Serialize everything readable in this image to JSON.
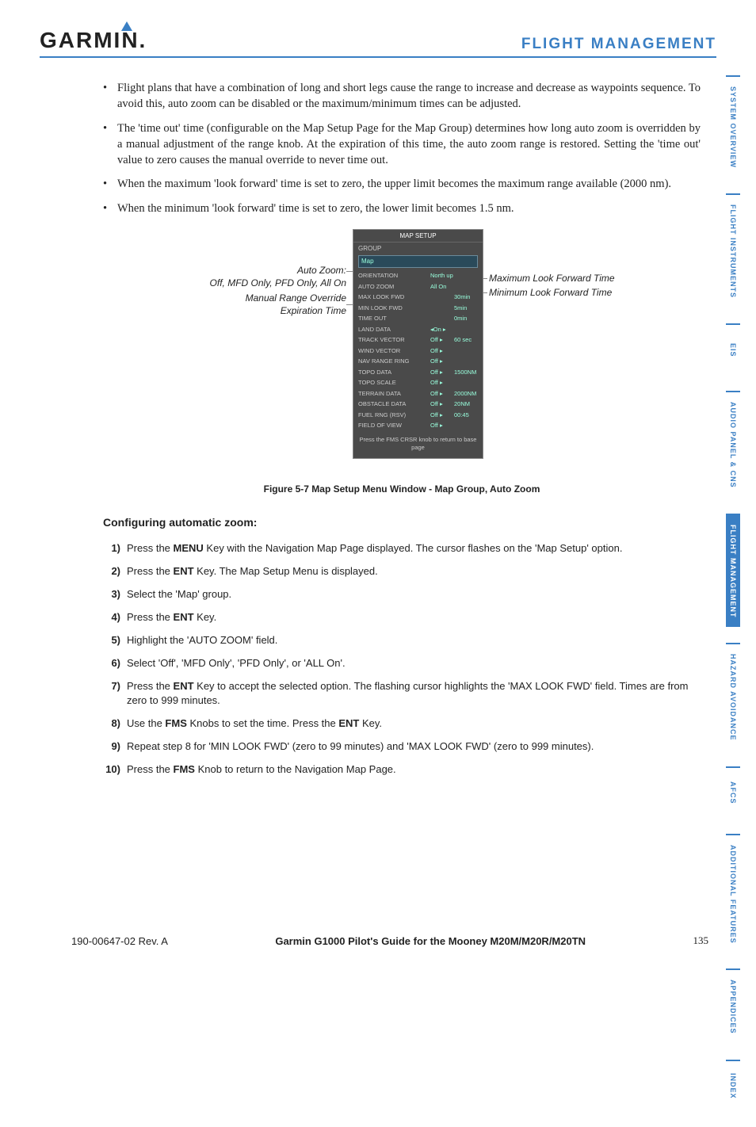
{
  "logo": "GARMIN",
  "section_title": "FLIGHT MANAGEMENT",
  "bullets": [
    "Flight plans that have a combination of long and short legs cause the range to increase and decrease as waypoints sequence.  To avoid this, auto zoom can be disabled or the maximum/minimum times can be adjusted.",
    "The 'time out' time (configurable on the Map Setup Page for the Map Group) determines how long auto zoom is overridden by a manual adjustment of the range knob.  At the expiration of this time, the auto zoom range is restored.  Setting the 'time out' value to zero causes the manual override to never time out.",
    "When the maximum 'look forward' time is set to zero, the upper limit becomes the maximum range available (2000 nm).",
    "When the minimum 'look forward' time is set to zero, the lower limit becomes 1.5 nm."
  ],
  "callouts": {
    "auto_zoom_title": "Auto Zoom:",
    "auto_zoom_sub": "Off, MFD Only, PFD Only, All On",
    "manual_line1": "Manual Range Override",
    "manual_line2": "Expiration Time",
    "max_fwd": "Maximum Look Forward Time",
    "min_fwd": "Minimum Look Forward Time"
  },
  "map_setup": {
    "title": "MAP SETUP",
    "group_label": "GROUP",
    "group_value": "Map",
    "rows": [
      {
        "label": "ORIENTATION",
        "val": "North up",
        "extra": ""
      },
      {
        "label": "AUTO ZOOM",
        "val": "All On",
        "extra": ""
      },
      {
        "label": "   MAX LOOK FWD",
        "val": "",
        "extra": "30min"
      },
      {
        "label": "   MIN LOOK FWD",
        "val": "",
        "extra": "5min"
      },
      {
        "label": "   TIME OUT",
        "val": "",
        "extra": "0min"
      },
      {
        "label": "LAND DATA",
        "val": "◂On ▸",
        "extra": ""
      },
      {
        "label": "TRACK VECTOR",
        "val": "Off ▸",
        "extra": "60 sec"
      },
      {
        "label": "WIND VECTOR",
        "val": "Off ▸",
        "extra": ""
      },
      {
        "label": "NAV RANGE RING",
        "val": "Off ▸",
        "extra": ""
      },
      {
        "label": "TOPO DATA",
        "val": "Off ▸",
        "extra": "1500NM"
      },
      {
        "label": "TOPO SCALE",
        "val": "Off ▸",
        "extra": ""
      },
      {
        "label": "TERRAIN DATA",
        "val": "Off ▸",
        "extra": "2000NM"
      },
      {
        "label": "OBSTACLE DATA",
        "val": "Off ▸",
        "extra": "20NM"
      },
      {
        "label": "FUEL RNG (RSV)",
        "val": "Off ▸",
        "extra": "00:45"
      },
      {
        "label": "FIELD OF VIEW",
        "val": "Off ▸",
        "extra": ""
      }
    ],
    "footer": "Press the FMS CRSR knob to return to base page"
  },
  "figure_caption": "Figure 5-7  Map Setup Menu Window - Map Group, Auto Zoom",
  "config_heading": "Configuring automatic zoom:",
  "steps": [
    {
      "n": "1)",
      "pre": "Press the ",
      "bold": "MENU",
      "post": " Key with the Navigation Map Page displayed.  The cursor flashes on the 'Map Setup' option."
    },
    {
      "n": "2)",
      "pre": "Press the ",
      "bold": "ENT",
      "post": " Key.  The Map Setup Menu is displayed."
    },
    {
      "n": "3)",
      "pre": "Select the 'Map' group.",
      "bold": "",
      "post": ""
    },
    {
      "n": "4)",
      "pre": "Press the ",
      "bold": "ENT",
      "post": " Key."
    },
    {
      "n": "5)",
      "pre": "Highlight the 'AUTO ZOOM' field.",
      "bold": "",
      "post": ""
    },
    {
      "n": "6)",
      "pre": "Select 'Off', 'MFD Only', 'PFD Only', or 'ALL On'.",
      "bold": "",
      "post": ""
    },
    {
      "n": "7)",
      "pre": "Press the ",
      "bold": "ENT",
      "post": " Key to accept the selected option.  The flashing cursor highlights the 'MAX LOOK FWD' field.  Times are from zero to 999 minutes."
    },
    {
      "n": "8)",
      "pre": "Use the ",
      "bold": "FMS",
      "post": " Knobs to set the time.  Press the ",
      "bold2": "ENT",
      "post2": " Key."
    },
    {
      "n": "9)",
      "pre": "Repeat step 8 for 'MIN LOOK FWD' (zero to 99 minutes) and 'MAX LOOK FWD' (zero to 999 minutes).",
      "bold": "",
      "post": ""
    },
    {
      "n": "10)",
      "pre": "Press the ",
      "bold": "FMS",
      "post": " Knob to return to the Navigation Map Page."
    }
  ],
  "tabs": [
    "SYSTEM OVERVIEW",
    "FLIGHT INSTRUMENTS",
    "EIS",
    "AUDIO PANEL & CNS",
    "FLIGHT MANAGEMENT",
    "HAZARD AVOIDANCE",
    "AFCS",
    "ADDITIONAL FEATURES",
    "APPENDICES",
    "INDEX"
  ],
  "active_tab": 4,
  "footer": {
    "rev": "190-00647-02  Rev. A",
    "title": "Garmin G1000 Pilot's Guide for the Mooney M20M/M20R/M20TN",
    "page": "135"
  }
}
